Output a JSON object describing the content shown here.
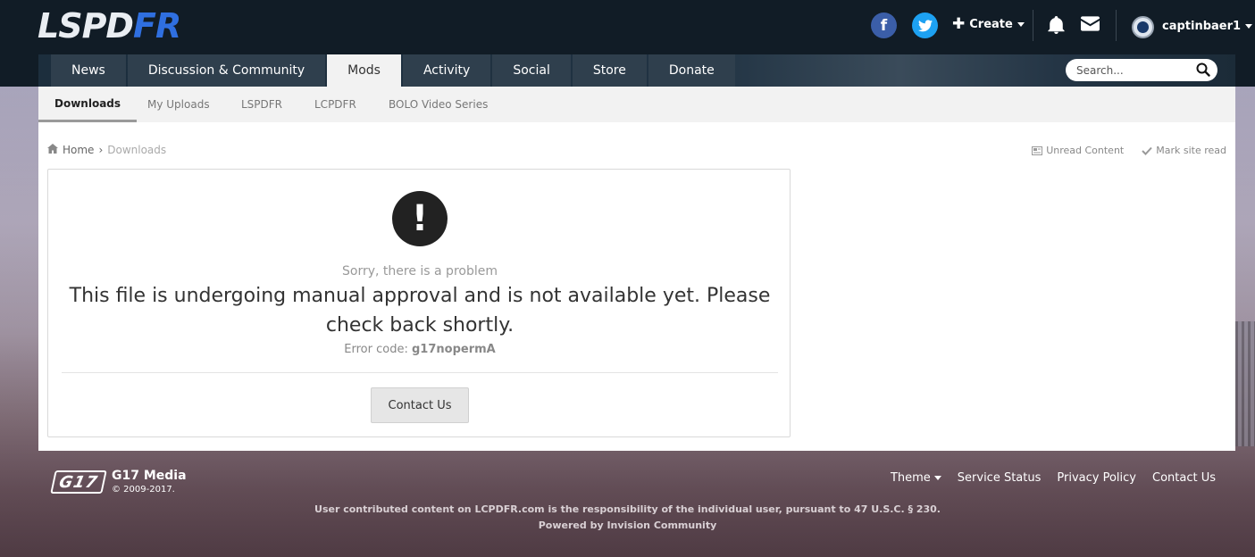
{
  "header": {
    "logo_part1": "LSPD",
    "logo_part2": "FR",
    "facebook_glyph": "f",
    "create_label": "Create",
    "username": "captinbaer1"
  },
  "nav": {
    "tabs": [
      {
        "label": "News"
      },
      {
        "label": "Discussion & Community"
      },
      {
        "label": "Mods",
        "active": true
      },
      {
        "label": "Activity"
      },
      {
        "label": "Social"
      },
      {
        "label": "Store"
      },
      {
        "label": "Donate"
      }
    ],
    "search_placeholder": "Search..."
  },
  "subnav": {
    "items": [
      {
        "label": "Downloads",
        "active": true
      },
      {
        "label": "My Uploads"
      },
      {
        "label": "LSPDFR"
      },
      {
        "label": "LCPDFR"
      },
      {
        "label": "BOLO Video Series"
      }
    ]
  },
  "breadcrumb": {
    "home": "Home",
    "separator": "›",
    "current": "Downloads"
  },
  "toplinks": {
    "unread": "Unread Content",
    "mark_read": "Mark site read"
  },
  "error": {
    "icon_glyph": "!",
    "sorry": "Sorry, there is a problem",
    "message": "This file is undergoing manual approval and is not available yet. Please check back shortly.",
    "code_label": "Error code:",
    "code": "g17nopermA",
    "contact_button": "Contact Us"
  },
  "footer": {
    "logo_text": "G17",
    "company": "G17 Media",
    "copyright": "© 2009-2017.",
    "links": {
      "theme": "Theme",
      "service_status": "Service Status",
      "privacy": "Privacy Policy",
      "contact": "Contact Us"
    },
    "disclaimer": "User contributed content on LCPDFR.com is the responsibility of the individual user, pursuant to 47 U.S.C. § 230.",
    "powered_by": "Powered by Invision Community"
  },
  "colors": {
    "header_bg": "#111c26",
    "logo_accent": "#2f6fe0",
    "facebook": "#3b5ea8",
    "twitter": "#1da1f2"
  }
}
